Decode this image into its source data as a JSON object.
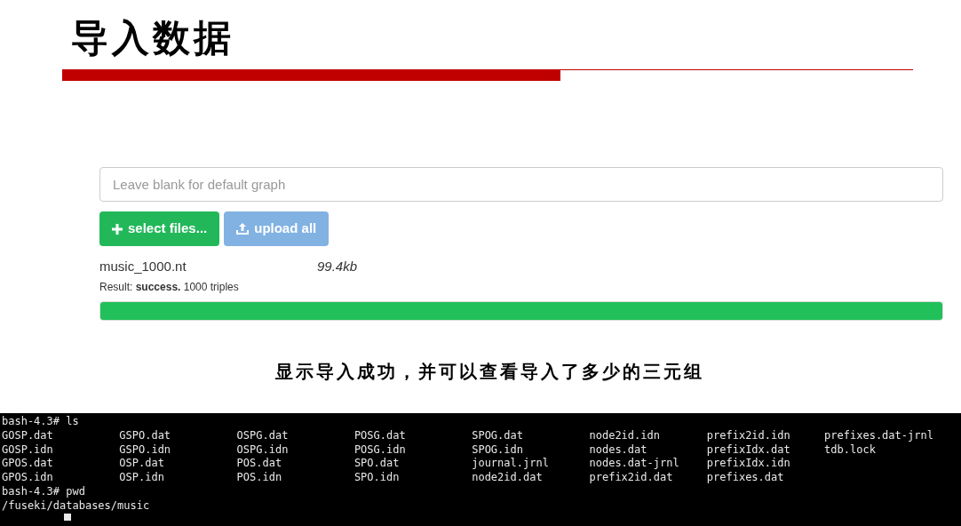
{
  "title": "导入数据",
  "upload_form": {
    "graph_field": {
      "placeholder": "Leave blank for default graph"
    },
    "buttons": [
      {
        "kind": "select",
        "label": "select files...",
        "disabled": false
      },
      {
        "kind": "upload",
        "label": "upload all",
        "disabled": true
      }
    ],
    "file": {
      "name": "music_1000.nt",
      "size": "99.4kb",
      "result": "Result: **success.** 1000 triples"
    },
    "progress": {
      "level": 1
    }
  },
  "caption": "显示导入成功，并可以查看导入了多少的三元组",
  "terminal": {
    "lines": [
      {
        "kind": "command",
        "text": "bash-4.3# ls"
      },
      {
        "kind": "listing",
        "columns": [
          [
            "GOSP.dat",
            "GOSP.idn",
            "GPOS.dat",
            "GPOS.idn"
          ],
          [
            "GSPO.dat",
            "GSPO.idn",
            "OSP.dat",
            "OSP.idn"
          ],
          [
            "OSPG.dat",
            "OSPG.idn",
            "POS.dat",
            "POS.idn"
          ],
          [
            "POSG.dat",
            "POSG.idn",
            "SPO.dat",
            "SPO.idn"
          ],
          [
            "SPOG.dat",
            "SPOG.idn",
            "journal.jrnl",
            "node2id.dat"
          ],
          [
            "node2id.idn",
            "nodes.dat",
            "nodes.dat-jrnl",
            "prefix2id.dat"
          ],
          [
            "prefix2id.idn",
            "prefixIdx.dat",
            "prefixIdx.idn",
            "prefixes.dat"
          ],
          [
            "prefixes.dat-jrnl",
            "tdb.lock"
          ]
        ]
      },
      {
        "kind": "command",
        "text": "bash-4.3# pwd"
      },
      {
        "kind": "output",
        "text": "/fuseki/databases/music"
      }
    ],
    "cursor": true
  }
}
